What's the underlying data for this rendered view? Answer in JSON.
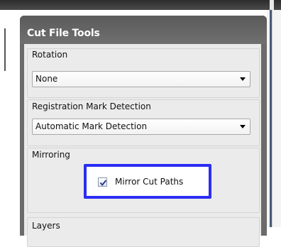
{
  "panel": {
    "title": "Cut File Tools"
  },
  "rotation": {
    "label": "Rotation",
    "selected": "None"
  },
  "registration": {
    "label": "Registration Mark Detection",
    "selected": "Automatic Mark Detection"
  },
  "mirroring": {
    "label": "Mirroring",
    "checkbox_label": "Mirror Cut Paths",
    "checked": true
  },
  "layers": {
    "label": "Layers"
  },
  "icons": {
    "dropdown": "chevron-down-icon",
    "check": "checkmark-icon"
  },
  "colors": {
    "highlight_border": "#2b2ef3",
    "panel_header": "#6b6b6b",
    "panel_body": "#ebebeb"
  }
}
